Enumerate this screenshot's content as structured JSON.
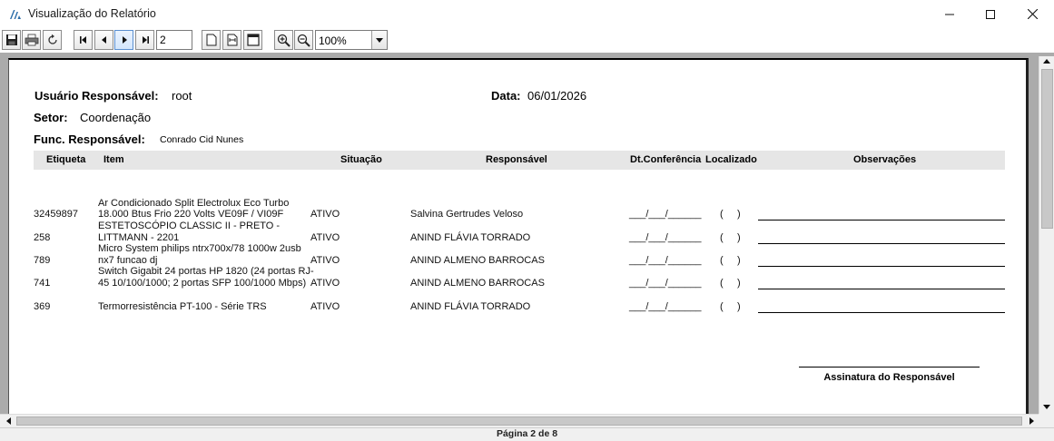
{
  "window": {
    "title": "Visualização do Relatório",
    "controls": [
      "minimize-icon",
      "maximize-icon",
      "close-icon"
    ]
  },
  "toolbar": {
    "buttons": [
      "save-icon",
      "print-icon",
      "refresh-icon",
      "first-page-icon",
      "previous-page-icon",
      "next-page-icon",
      "last-page-icon",
      "single-page-icon",
      "page-width-icon",
      "two-pages-icon",
      "zoom-in-icon",
      "zoom-out-icon"
    ],
    "page_number": "2",
    "zoom": "100%"
  },
  "report": {
    "usuario_label": "Usuário Responsável:",
    "usuario_value": "root",
    "data_label": "Data:",
    "data_value": "06/01/2026",
    "setor_label": "Setor:",
    "setor_value": "Coordenação",
    "func_label": "Func. Responsável:",
    "func_value": "Conrado Cid Nunes",
    "columns": [
      "Etiqueta",
      "Item",
      "Situação",
      "Responsável",
      "Dt.Conferência",
      "Localizado",
      "Observações"
    ],
    "rows": [
      {
        "etiqueta": "32459897",
        "item_line1": "Ar Condicionado Split Electrolux Eco Turbo",
        "item_line2": "18.000 Btus Frio 220 Volts VE09F / VI09F",
        "situacao": "ATIVO",
        "responsavel": "Salvina Gertrudes Veloso",
        "dt": "___/___/______",
        "localizado": "(     )"
      },
      {
        "etiqueta": "258",
        "item_line1": "ESTETOSCÓPIO CLASSIC II - PRETO -",
        "item_line2": "LITTMANN - 2201",
        "situacao": "ATIVO",
        "responsavel": "ANIND FLÁVIA TORRADO",
        "dt": "___/___/______",
        "localizado": "(     )"
      },
      {
        "etiqueta": "789",
        "item_line1": "Micro System philips ntrx700x/78 1000w 2usb",
        "item_line2": "nx7 funcao dj",
        "situacao": "ATIVO",
        "responsavel": "ANIND ALMENO BARROCAS",
        "dt": "___/___/______",
        "localizado": "(     )"
      },
      {
        "etiqueta": "741",
        "item_line1": "Switch Gigabit 24 portas HP 1820 (24 portas RJ-",
        "item_line2": "45 10/100/1000; 2 portas SFP 100/1000 Mbps)",
        "situacao": "ATIVO",
        "responsavel": "ANIND ALMENO BARROCAS",
        "dt": "___/___/______",
        "localizado": "(     )"
      },
      {
        "etiqueta": "369",
        "item_line1": "",
        "item_line2": "Termorresistência PT-100 - Série TRS",
        "situacao": "ATIVO",
        "responsavel": "ANIND FLÁVIA TORRADO",
        "dt": "___/___/______",
        "localizado": "(     )"
      }
    ],
    "signature_label": "Assinatura do Responsável"
  },
  "status": {
    "page_text": "Página 2 de 8"
  }
}
